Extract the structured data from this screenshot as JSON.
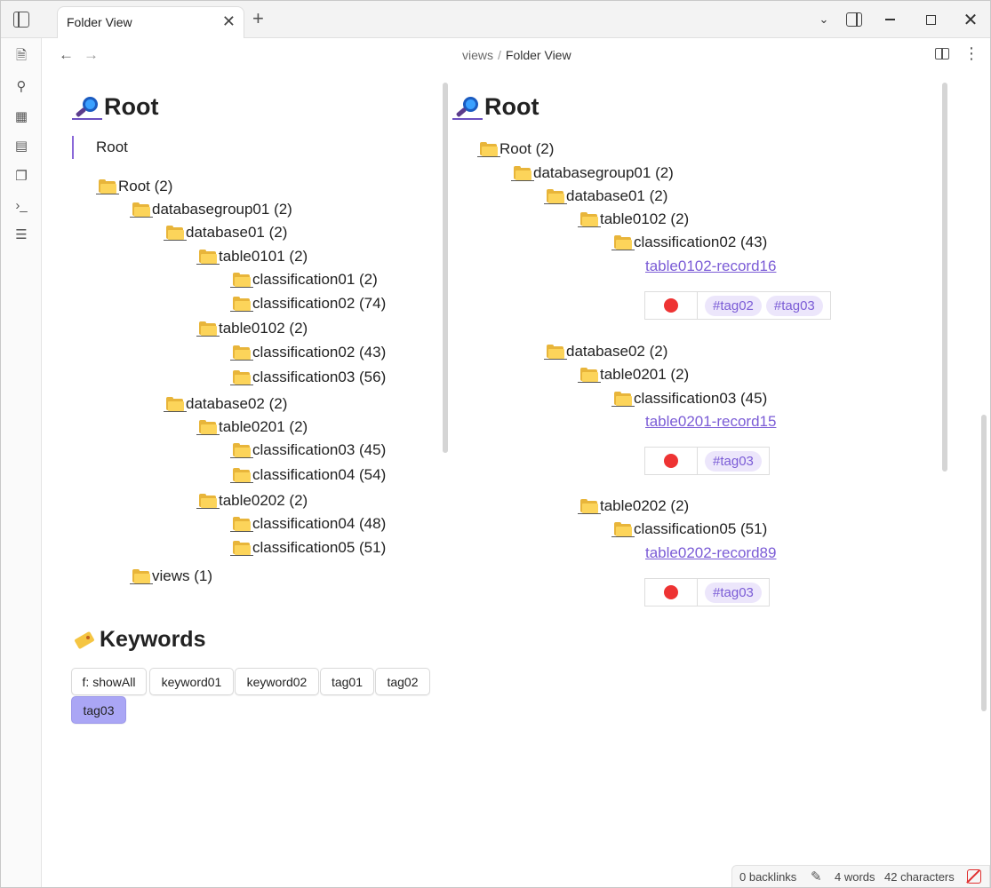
{
  "window": {
    "tab_title": "Folder View",
    "tab_close": "✕",
    "new_tab": "+",
    "chevron": "⌄",
    "close_glyph": "✕"
  },
  "ribbon": {
    "icons": [
      "file-search-icon",
      "graph-icon",
      "grid-icon",
      "calendar-icon",
      "copy-icon",
      "terminal-icon",
      "list-icon"
    ],
    "glyphs": [
      "🗎",
      "⚲",
      "▦",
      "▤",
      "❐",
      "›_",
      "☰"
    ]
  },
  "nav": {
    "back": "←",
    "forward": "→",
    "crumb_parent": "views",
    "crumb_sep": "/",
    "crumb_current": "Folder View",
    "more": "⋮"
  },
  "left": {
    "heading": "Root",
    "quote": "Root",
    "tree": [
      {
        "text": "Root (2)"
      },
      {
        "text": "databasegroup01 (2)"
      },
      {
        "text": "database01 (2)"
      },
      {
        "text": "table0101 (2)"
      },
      {
        "text": "classification01 (2)"
      },
      {
        "text": "classification02 (74)"
      },
      {
        "text": "table0102 (2)"
      },
      {
        "text": "classification02 (43)"
      },
      {
        "text": "classification03 (56)"
      },
      {
        "text": "database02 (2)"
      },
      {
        "text": "table0201 (2)"
      },
      {
        "text": "classification03 (45)"
      },
      {
        "text": "classification04 (54)"
      },
      {
        "text": "table0202 (2)"
      },
      {
        "text": "classification04 (48)"
      },
      {
        "text": "classification05 (51)"
      },
      {
        "text": "views (1)"
      }
    ],
    "keywords_heading": "Keywords",
    "keywords": [
      {
        "label": "f: showAll",
        "active": false
      },
      {
        "label": "keyword01",
        "active": false
      },
      {
        "label": "keyword02",
        "active": false
      },
      {
        "label": "tag01",
        "active": false
      },
      {
        "label": "tag02",
        "active": false
      },
      {
        "label": "tag03",
        "active": true
      }
    ]
  },
  "right": {
    "heading": "Root",
    "tree": [
      {
        "text": "Root (2)"
      },
      {
        "text": "databasegroup01 (2)"
      },
      {
        "text": "database01 (2)"
      },
      {
        "text": "table0102 (2)"
      },
      {
        "text": "classification02 (43)"
      },
      {
        "text": "database02 (2)"
      },
      {
        "text": "table0201 (2)"
      },
      {
        "text": "classification03 (45)"
      },
      {
        "text": "table0202 (2)"
      },
      {
        "text": "classification05 (51)"
      }
    ],
    "records": [
      {
        "link": "table0102-record16",
        "status_color": "#ee3333",
        "tags": [
          "#tag02",
          "#tag03"
        ]
      },
      {
        "link": "table0201-record15",
        "status_color": "#ee3333",
        "tags": [
          "#tag03"
        ]
      },
      {
        "link": "table0202-record89",
        "status_color": "#ee3333",
        "tags": [
          "#tag03"
        ]
      }
    ]
  },
  "status": {
    "backlinks": "0 backlinks",
    "pen": "✎",
    "words": "4 words",
    "characters": "42 characters"
  },
  "colors": {
    "accent": "#7b5cd6",
    "active_keyword": "#aaa6f5",
    "tag_bg": "#ece6fb",
    "status_red": "#ee3333"
  }
}
